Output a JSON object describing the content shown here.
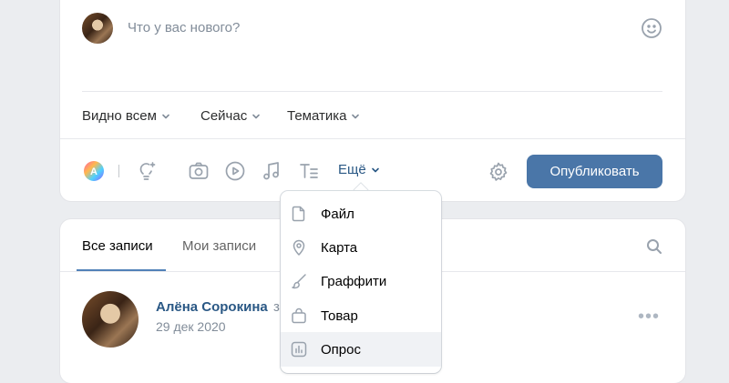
{
  "composer": {
    "placeholder": "Что у вас нового?",
    "visibility": "Видно всем",
    "time": "Сейчас",
    "topic": "Тематика",
    "more": "Ещё",
    "publish": "Опубликовать"
  },
  "icons": {
    "emoji": "smile-icon",
    "ai": "ai-avatar-icon",
    "idea": "lightbulb-icon",
    "photo": "camera-icon",
    "video": "play-icon",
    "music": "music-icon",
    "text": "text-format-icon",
    "settings": "gear-icon"
  },
  "feed": {
    "tabs": [
      "Все записи",
      "Мои записи"
    ],
    "post": {
      "author": "Алёна Сорокина",
      "author_suffix": "з",
      "date": "29 дек 2020"
    }
  },
  "dropdown": {
    "items": [
      {
        "label": "Файл",
        "icon": "file-icon"
      },
      {
        "label": "Карта",
        "icon": "map-pin-icon"
      },
      {
        "label": "Граффити",
        "icon": "brush-icon"
      },
      {
        "label": "Товар",
        "icon": "shopping-bag-icon"
      },
      {
        "label": "Опрос",
        "icon": "poll-icon"
      }
    ]
  },
  "colors": {
    "accent": "#4a76a8",
    "link": "#2a5885",
    "background": "#ebedf0",
    "muted": "#818c99"
  }
}
